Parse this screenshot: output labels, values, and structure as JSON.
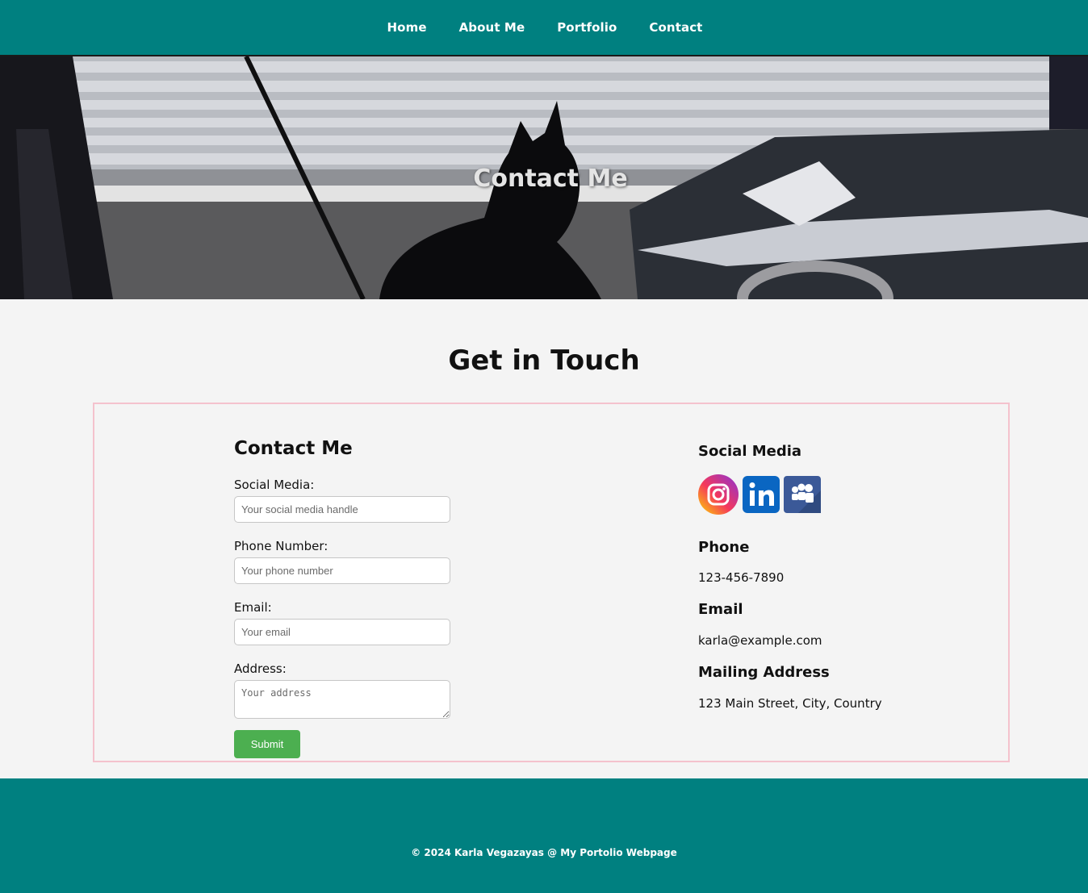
{
  "nav": {
    "items": [
      {
        "label": "Home"
      },
      {
        "label": "About Me"
      },
      {
        "label": "Portfolio"
      },
      {
        "label": "Contact"
      }
    ]
  },
  "hero": {
    "title": "Contact Me"
  },
  "main": {
    "section_title": "Get in Touch",
    "form": {
      "heading": "Contact Me",
      "social": {
        "label": "Social Media:",
        "placeholder": "Your social media handle",
        "value": ""
      },
      "phone": {
        "label": "Phone Number:",
        "placeholder": "Your phone number",
        "value": ""
      },
      "email": {
        "label": "Email:",
        "placeholder": "Your email",
        "value": ""
      },
      "address": {
        "label": "Address:",
        "placeholder": "Your address",
        "value": ""
      },
      "submit_label": "Submit"
    },
    "info": {
      "social_heading": "Social Media",
      "social_icons": [
        "instagram-icon",
        "linkedin-icon",
        "myspace-icon"
      ],
      "phone_heading": "Phone",
      "phone_value": "123-456-7890",
      "email_heading": "Email",
      "email_value": "karla@example.com",
      "mailing_heading": "Mailing Address",
      "mailing_value": "123 Main Street, City, Country"
    }
  },
  "footer": {
    "text": "© 2024 Karla Vegazayas @ My Portolio Webpage"
  },
  "colors": {
    "primary": "#008080",
    "submit": "#4caf50",
    "card_border": "#f4c2cd"
  }
}
